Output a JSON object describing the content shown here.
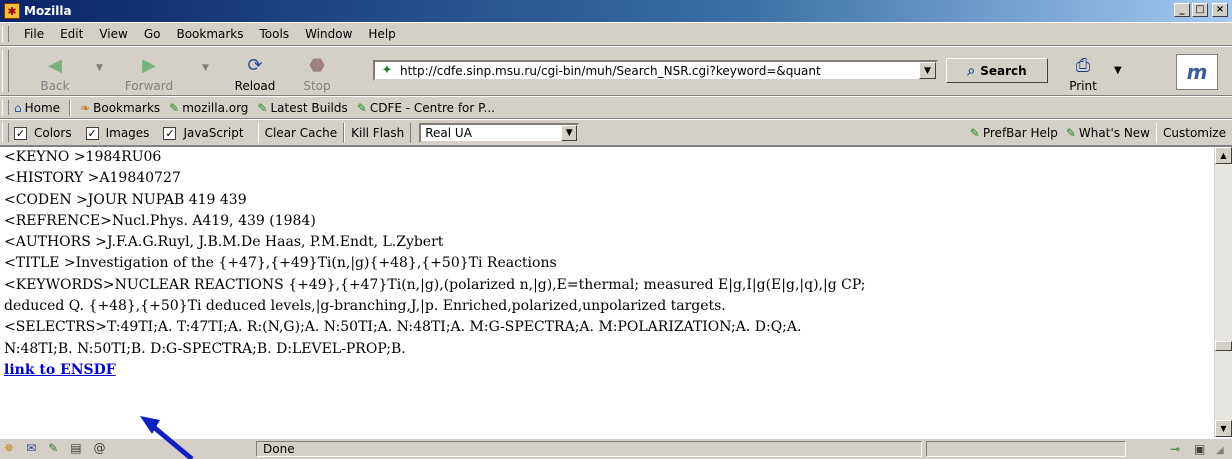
{
  "window": {
    "title": "Mozilla",
    "controls": {
      "minimize": "_",
      "maximize": "□",
      "close": "×"
    }
  },
  "menu": {
    "items": [
      "File",
      "Edit",
      "View",
      "Go",
      "Bookmarks",
      "Tools",
      "Window",
      "Help"
    ]
  },
  "navbar": {
    "back": "Back",
    "forward": "Forward",
    "reload": "Reload",
    "stop": "Stop",
    "url": "http://cdfe.sinp.msu.ru/cgi-bin/muh/Search_NSR.cgi?keyword=&quant",
    "search": "Search",
    "print": "Print"
  },
  "personal_bar": {
    "items": [
      "Home",
      "Bookmarks",
      "mozilla.org",
      "Latest Builds",
      "CDFE - Centre for P..."
    ]
  },
  "prefbar": {
    "colors": "Colors",
    "images": "Images",
    "javascript": "JavaScript",
    "clear_cache": "Clear Cache",
    "kill_flash": "Kill Flash",
    "ua_select": "Real UA",
    "prefbar_help": "PrefBar Help",
    "whats_new": "What's New",
    "customize": "Customize"
  },
  "content": {
    "lines": [
      "<KEYNO >1984RU06",
      "<HISTORY >A19840727",
      "<CODEN >JOUR NUPAB 419 439",
      "<REFRENCE>Nucl.Phys. A419, 439 (1984)",
      "<AUTHORS >J.F.A.G.Ruyl, J.B.M.De Haas, P.M.Endt, L.Zybert",
      "<TITLE >Investigation of the {+47},{+49}Ti(n,|g){+48},{+50}Ti Reactions",
      "<KEYWORDS>NUCLEAR REACTIONS {+49},{+47}Ti(n,|g),(polarized n,|g),E=thermal; measured E|g,I|g(E|g,|q),|g CP;",
      "deduced Q. {+48},{+50}Ti deduced levels,|g-branching,J,|p. Enriched,polarized,unpolarized targets.",
      "<SELECTRS>T:49TI;A. T:47TI;A. R:(N,G);A. N:50TI;A. N:48TI;A. M:G-SPECTRA;A. M:POLARIZATION;A. D:Q;A.",
      "N:48TI;B. N:50TI;B. D:G-SPECTRA;B. D:LEVEL-PROP;B."
    ],
    "link": "link to ENSDF"
  },
  "status": {
    "text": "Done"
  }
}
